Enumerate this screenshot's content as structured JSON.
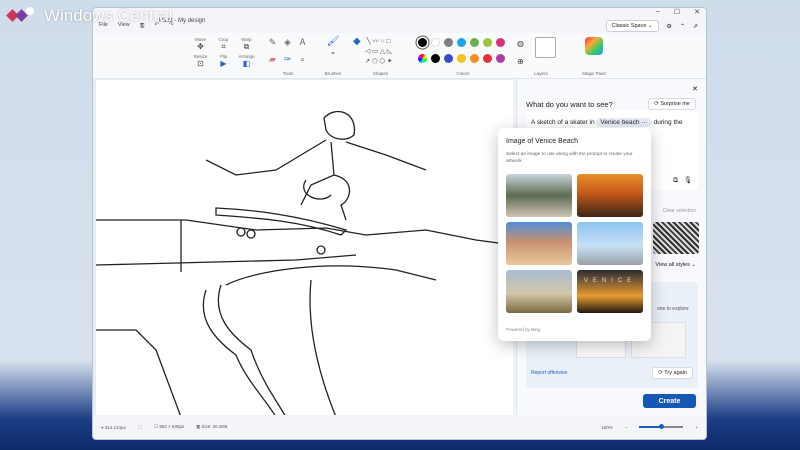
{
  "watermark": "Windows Central",
  "window": {
    "title": "Paint - My design",
    "menu": [
      "File",
      "View"
    ],
    "space": "Classic Space"
  },
  "ribbon": {
    "image": [
      "Move",
      "Crop",
      "Warp",
      "Resize",
      "Flip",
      "Arrange"
    ],
    "groups": {
      "tools": "Tools",
      "brushes": "Brushes",
      "shapes": "Shapes",
      "colors": "Colors",
      "layers": "Layers",
      "magic": "Magic Paint"
    },
    "colors": [
      "#000000",
      "#ffffff",
      "#7f7f7f",
      "#1aa3e8",
      "#6ab04c",
      "#9bc53d",
      "#d6307a",
      "#000000",
      "#3a49c9",
      "#f7c21a",
      "#f68b1f",
      "#e5323a",
      "#b03a9c"
    ]
  },
  "panel": {
    "heading": "What do you want to see?",
    "surprise": "Surprise me",
    "prompt_before": "A sketch of a skater in",
    "chip": "Venice beach",
    "prompt_after": "during the",
    "clear": "Clear selection",
    "view_styles": "View all styles",
    "explore": "one to explore",
    "report": "Report offensive",
    "try_again": "Try again",
    "create": "Create"
  },
  "popup": {
    "title": "Image of Venice Beach",
    "desc": "Select an image to use along with the prompt to create your artwork",
    "footer": "Powered by Bing",
    "venice_sign": "VENICE"
  },
  "status": {
    "cursor": "314,124px",
    "canvas_size": "962 × 635px",
    "file_size": "Size: 20.4KB",
    "zoom": "100%",
    "zoom_fraction": 0.5
  }
}
